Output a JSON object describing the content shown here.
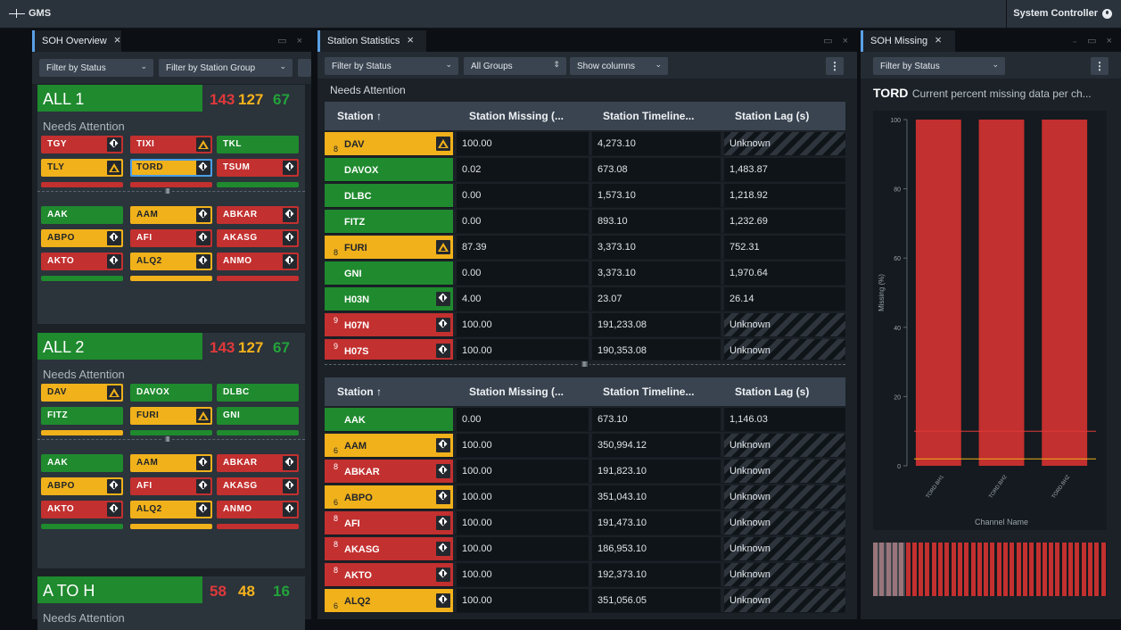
{
  "app": {
    "title": "GMS",
    "user": "System Controller"
  },
  "overview": {
    "tab": "SOH Overview",
    "filter_status": "Filter by Status",
    "filter_group": "Filter by Station Group",
    "groups": [
      {
        "name": "ALL 1",
        "red": "143",
        "yellow": "127",
        "green": "67",
        "needs_attention": "Needs Attention",
        "attention": [
          {
            "label": "TGY",
            "status": "r",
            "icon": "dia"
          },
          {
            "label": "TIXI",
            "status": "r",
            "icon": "tri"
          },
          {
            "label": "TKL",
            "status": "g",
            "icon": ""
          },
          {
            "label": "TLY",
            "status": "y",
            "icon": "tri"
          },
          {
            "label": "TORD",
            "status": "y",
            "icon": "dia",
            "selected": true
          },
          {
            "label": "TSUM",
            "status": "r",
            "icon": "dia"
          }
        ],
        "others": [
          {
            "label": "AAK",
            "status": "g",
            "icon": ""
          },
          {
            "label": "AAM",
            "status": "y",
            "icon": "dia"
          },
          {
            "label": "ABKAR",
            "status": "r",
            "icon": "dia"
          },
          {
            "label": "ABPO",
            "status": "y",
            "icon": "dia"
          },
          {
            "label": "AFI",
            "status": "r",
            "icon": "dia"
          },
          {
            "label": "AKASG",
            "status": "r",
            "icon": "dia"
          },
          {
            "label": "AKTO",
            "status": "r",
            "icon": "dia"
          },
          {
            "label": "ALQ2",
            "status": "y",
            "icon": "dia"
          },
          {
            "label": "ANMO",
            "status": "r",
            "icon": "dia"
          }
        ]
      },
      {
        "name": "ALL 2",
        "red": "143",
        "yellow": "127",
        "green": "67",
        "needs_attention": "Needs Attention",
        "attention": [
          {
            "label": "DAV",
            "status": "y",
            "icon": "tri"
          },
          {
            "label": "DAVOX",
            "status": "g",
            "icon": ""
          },
          {
            "label": "DLBC",
            "status": "g",
            "icon": ""
          },
          {
            "label": "FITZ",
            "status": "g",
            "icon": ""
          },
          {
            "label": "FURI",
            "status": "y",
            "icon": "tri"
          },
          {
            "label": "GNI",
            "status": "g",
            "icon": ""
          }
        ],
        "others": [
          {
            "label": "AAK",
            "status": "g",
            "icon": ""
          },
          {
            "label": "AAM",
            "status": "y",
            "icon": "dia"
          },
          {
            "label": "ABKAR",
            "status": "r",
            "icon": "dia"
          },
          {
            "label": "ABPO",
            "status": "y",
            "icon": "dia"
          },
          {
            "label": "AFI",
            "status": "r",
            "icon": "dia"
          },
          {
            "label": "AKASG",
            "status": "r",
            "icon": "dia"
          },
          {
            "label": "AKTO",
            "status": "r",
            "icon": "dia"
          },
          {
            "label": "ALQ2",
            "status": "y",
            "icon": "dia"
          },
          {
            "label": "ANMO",
            "status": "r",
            "icon": "dia"
          }
        ]
      },
      {
        "name": "A TO H",
        "red": "58",
        "yellow": "48",
        "green": "16",
        "needs_attention": "Needs Attention"
      }
    ]
  },
  "stats": {
    "tab": "Station Statistics",
    "filter_status": "Filter by Status",
    "all_groups": "All Groups",
    "show_columns": "Show columns",
    "needs_attention": "Needs Attention",
    "columns": [
      "Station ↑",
      "Station Missing (...",
      "Station Timeline...",
      "Station Lag (s)"
    ],
    "top_rows": [
      {
        "station": "DAV",
        "status": "y",
        "icon": "tri",
        "sub": "8",
        "sup": "",
        "missing": "100.00",
        "timeliness": "4,273.10",
        "lag": "Unknown",
        "hatch": true
      },
      {
        "station": "DAVOX",
        "status": "g",
        "icon": "",
        "sub": "",
        "sup": "",
        "missing": "0.02",
        "timeliness": "673.08",
        "lag": "1,483.87",
        "hatch": false
      },
      {
        "station": "DLBC",
        "status": "g",
        "icon": "",
        "sub": "",
        "sup": "",
        "missing": "0.00",
        "timeliness": "1,573.10",
        "lag": "1,218.92",
        "hatch": false
      },
      {
        "station": "FITZ",
        "status": "g",
        "icon": "",
        "sub": "",
        "sup": "",
        "missing": "0.00",
        "timeliness": "893.10",
        "lag": "1,232.69",
        "hatch": false
      },
      {
        "station": "FURI",
        "status": "y",
        "icon": "tri",
        "sub": "8",
        "sup": "",
        "missing": "87.39",
        "timeliness": "3,373.10",
        "lag": "752.31",
        "hatch": false
      },
      {
        "station": "GNI",
        "status": "g",
        "icon": "",
        "sub": "",
        "sup": "",
        "missing": "0.00",
        "timeliness": "3,373.10",
        "lag": "1,970.64",
        "hatch": false
      },
      {
        "station": "H03N",
        "status": "g",
        "icon": "dia",
        "sub": "",
        "sup": "",
        "missing": "4.00",
        "timeliness": "23.07",
        "lag": "26.14",
        "hatch": false
      },
      {
        "station": "H07N",
        "status": "r",
        "icon": "dia",
        "sub": "",
        "sup": "9",
        "missing": "100.00",
        "timeliness": "191,233.08",
        "lag": "Unknown",
        "hatch": true
      },
      {
        "station": "H07S",
        "status": "r",
        "icon": "dia",
        "sub": "",
        "sup": "9",
        "missing": "100.00",
        "timeliness": "190,353.08",
        "lag": "Unknown",
        "hatch": true
      }
    ],
    "bottom_rows": [
      {
        "station": "AAK",
        "status": "g",
        "icon": "",
        "sub": "",
        "sup": "",
        "missing": "0.00",
        "timeliness": "673.10",
        "lag": "1,146.03",
        "hatch": false
      },
      {
        "station": "AAM",
        "status": "y",
        "icon": "dia",
        "sub": "6",
        "sup": "",
        "missing": "100.00",
        "timeliness": "350,994.12",
        "lag": "Unknown",
        "hatch": true
      },
      {
        "station": "ABKAR",
        "status": "r",
        "icon": "dia",
        "sub": "",
        "sup": "8",
        "missing": "100.00",
        "timeliness": "191,823.10",
        "lag": "Unknown",
        "hatch": true
      },
      {
        "station": "ABPO",
        "status": "y",
        "icon": "dia",
        "sub": "6",
        "sup": "",
        "missing": "100.00",
        "timeliness": "351,043.10",
        "lag": "Unknown",
        "hatch": true
      },
      {
        "station": "AFI",
        "status": "r",
        "icon": "dia",
        "sub": "",
        "sup": "8",
        "missing": "100.00",
        "timeliness": "191,473.10",
        "lag": "Unknown",
        "hatch": true
      },
      {
        "station": "AKASG",
        "status": "r",
        "icon": "dia",
        "sub": "",
        "sup": "8",
        "missing": "100.00",
        "timeliness": "186,953.10",
        "lag": "Unknown",
        "hatch": true
      },
      {
        "station": "AKTO",
        "status": "r",
        "icon": "dia",
        "sub": "",
        "sup": "8",
        "missing": "100.00",
        "timeliness": "192,373.10",
        "lag": "Unknown",
        "hatch": true
      },
      {
        "station": "ALQ2",
        "status": "y",
        "icon": "dia",
        "sub": "6",
        "sup": "",
        "missing": "100.00",
        "timeliness": "351,056.05",
        "lag": "Unknown",
        "hatch": true
      }
    ]
  },
  "missing": {
    "tab": "SOH Missing",
    "filter_status": "Filter by Status",
    "station": "TORD",
    "subtitle": "Current percent missing data per ch..."
  },
  "chart_data": {
    "type": "bar",
    "title": "TORD Current percent missing data per ch...",
    "xlabel": "Channel Name",
    "ylabel": "Missing (%)",
    "categories": [
      "TORD.BH1",
      "TORD.BH2",
      "TORD.BHZ"
    ],
    "values": [
      100,
      100,
      100
    ],
    "ylim": [
      0,
      100
    ],
    "yticks": [
      "0",
      "20",
      "40",
      "60",
      "80",
      "100"
    ],
    "threshold_lines": [
      {
        "value": 10,
        "color": "#e0393a"
      },
      {
        "value": 2,
        "color": "#f0b11b"
      }
    ],
    "bar_color": "#c2302f",
    "grid": false
  },
  "colors": {
    "good": "#1f8a2e",
    "marginal": "#f0b11b",
    "bad": "#c2302f",
    "accent": "#5aa0e6"
  }
}
